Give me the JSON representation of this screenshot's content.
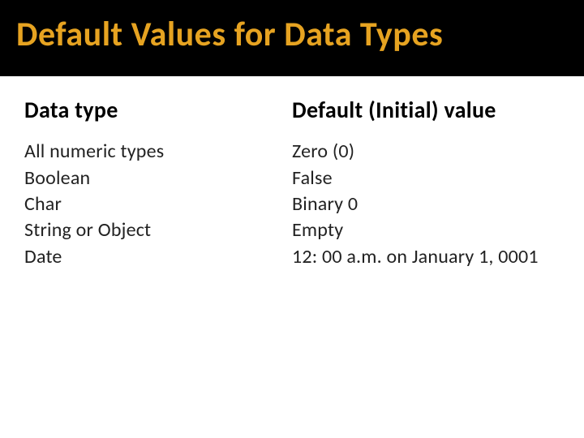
{
  "title": "Default Values for Data Types",
  "headers": {
    "type": "Data type",
    "value": "Default (Initial) value"
  },
  "rows": [
    {
      "type": "All numeric types",
      "value": "Zero (0)"
    },
    {
      "type": "Boolean",
      "value": "False"
    },
    {
      "type": "Char",
      "value": "Binary 0"
    },
    {
      "type": "String or Object",
      "value": "Empty"
    },
    {
      "type": "Date",
      "value": "12: 00 a.m. on January 1, 0001"
    }
  ]
}
